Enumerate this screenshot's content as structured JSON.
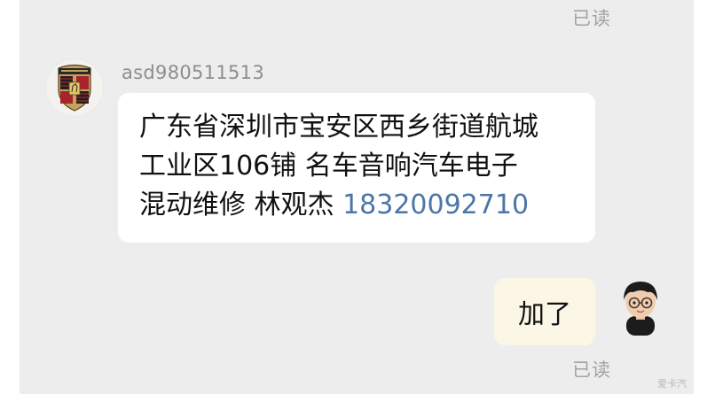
{
  "chat": {
    "read_status_top": "已读",
    "incoming": {
      "sender_name": "asd980511513",
      "avatar": "crest-avatar-icon",
      "lines": [
        "广东省深圳市宝安区西乡街道航城",
        "工业区106铺 名车音响汽车电子",
        "混动维修 林观杰 "
      ],
      "phone": "18320092710"
    },
    "outgoing": {
      "text": "加了",
      "avatar": "memoji-avatar-icon",
      "read_status": "已读"
    }
  },
  "watermark": "爱卡汽",
  "colors": {
    "chat_background": "#ededed",
    "incoming_bubble": "#ffffff",
    "outgoing_bubble": "#fbf6e6",
    "link": "#4b76a7",
    "status_text": "#a3a3a3"
  }
}
